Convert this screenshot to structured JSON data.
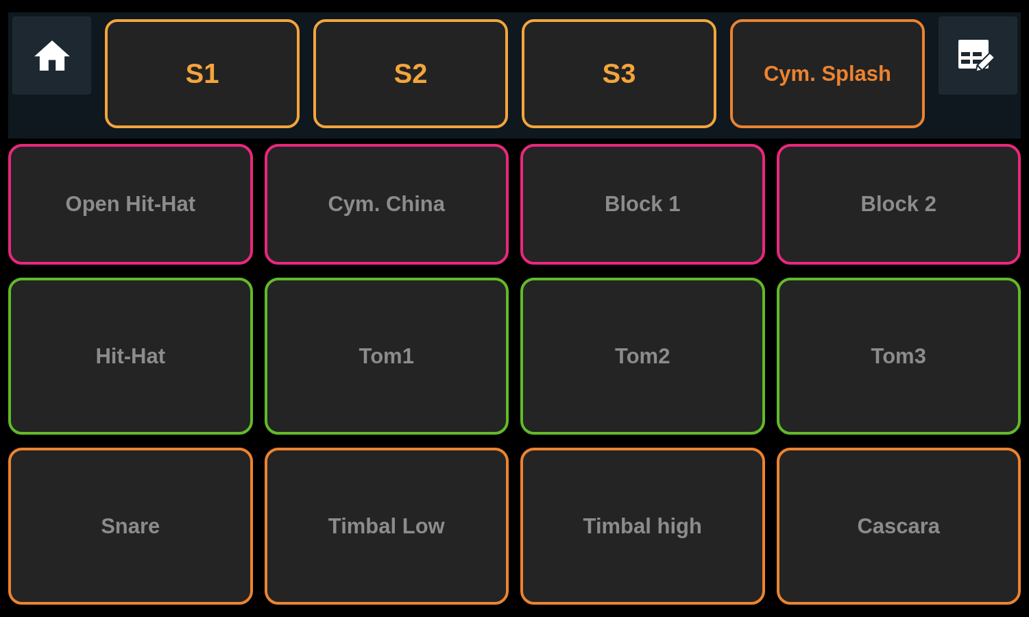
{
  "top_bar": {
    "slots": [
      {
        "label": "S1",
        "color": "#f4a53c"
      },
      {
        "label": "S2",
        "color": "#f4a53c"
      },
      {
        "label": "S3",
        "color": "#f4a53c"
      },
      {
        "label": "Cym. Splash",
        "color": "#ec8330"
      }
    ]
  },
  "pads": [
    {
      "label": "Open Hit-Hat",
      "color": "#e9287c"
    },
    {
      "label": "Cym. China",
      "color": "#e9287c"
    },
    {
      "label": "Block 1",
      "color": "#e9287c"
    },
    {
      "label": "Block 2",
      "color": "#e9287c"
    },
    {
      "label": "Hit-Hat",
      "color": "#62ba28"
    },
    {
      "label": "Tom1",
      "color": "#62ba28"
    },
    {
      "label": "Tom2",
      "color": "#62ba28"
    },
    {
      "label": "Tom3",
      "color": "#62ba28"
    },
    {
      "label": "Snare",
      "color": "#ec8330"
    },
    {
      "label": "Timbal Low",
      "color": "#ec8330"
    },
    {
      "label": "Timbal high",
      "color": "#ec8330"
    },
    {
      "label": "Cascara",
      "color": "#ec8330"
    }
  ]
}
